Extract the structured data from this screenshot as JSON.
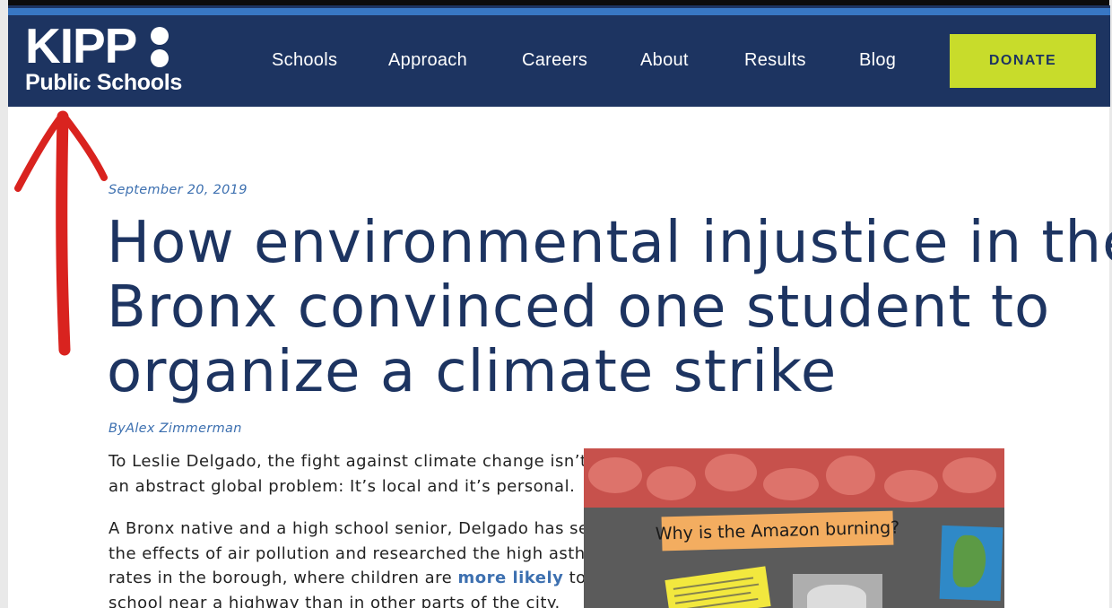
{
  "header": {
    "logo": {
      "wordmark": "KIPP",
      "subtitle": "Public Schools"
    },
    "nav": [
      {
        "label": "Schools"
      },
      {
        "label": "Approach"
      },
      {
        "label": "Careers"
      },
      {
        "label": "About"
      },
      {
        "label": "Results"
      },
      {
        "label": "Blog"
      }
    ],
    "donate_label": "DONATE"
  },
  "annotation": {
    "icon": "red-arrow-up-icon",
    "color": "#d9231f"
  },
  "article": {
    "date": "September 20, 2019",
    "headline_lines": [
      "How environmental injustice in the",
      "Bronx convinced one student to",
      "organize a climate strike"
    ],
    "byline": "ByAlex Zimmerman",
    "paragraph1_lines": [
      "To Leslie Delgado, the fight against climate change isn’t just",
      "an abstract global problem: It’s local and it’s personal."
    ],
    "paragraph2": {
      "line1": "A Bronx native and a high school senior, Delgado has seen",
      "line2": "the effects of air pollution and researched the high asthma",
      "line3_before": "rates in the borough, where children are ",
      "line3_link": "more likely",
      "line3_after": " to go to",
      "line4": "school near a highway than in other parts of the city."
    },
    "photo": {
      "sign_text": "Why is the Amazon burning?"
    }
  },
  "colors": {
    "header_bg": "#1d3461",
    "header_stripe": "#3877c4",
    "donate_bg": "#c8dc2b",
    "link": "#3d70b0",
    "headline": "#1d3461"
  }
}
